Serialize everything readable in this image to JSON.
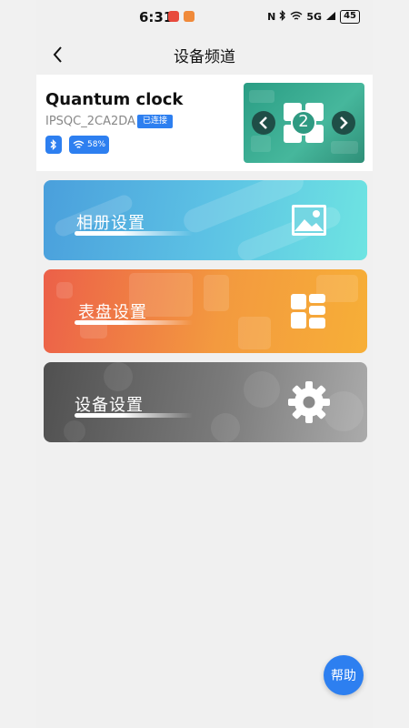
{
  "status_bar": {
    "time": "6:31",
    "signal": "5G",
    "battery": "45"
  },
  "header": {
    "title": "设备频道",
    "back_icon": "chevron-left-icon"
  },
  "device": {
    "name": "Quantum clock",
    "id": "IPSQC_2CA2DA",
    "connection_status": "已连接",
    "bluetooth_icon": "bluetooth-icon",
    "wifi_icon": "wifi-icon",
    "wifi_strength": "58%",
    "preview_page": "2"
  },
  "menu": {
    "album": {
      "label": "相册设置",
      "icon": "image-icon"
    },
    "dial": {
      "label": "表盘设置",
      "icon": "grid-layout-icon"
    },
    "settings": {
      "label": "设备设置",
      "icon": "gear-icon"
    }
  },
  "help_button": {
    "label": "帮助"
  },
  "colors": {
    "accent": "#2d7ff0",
    "album_gradient": [
      "#4a9fdc",
      "#6ee4e2"
    ],
    "dial_gradient": [
      "#ec6049",
      "#f7af37"
    ],
    "settings_gradient": [
      "#505050",
      "#ababab"
    ]
  }
}
